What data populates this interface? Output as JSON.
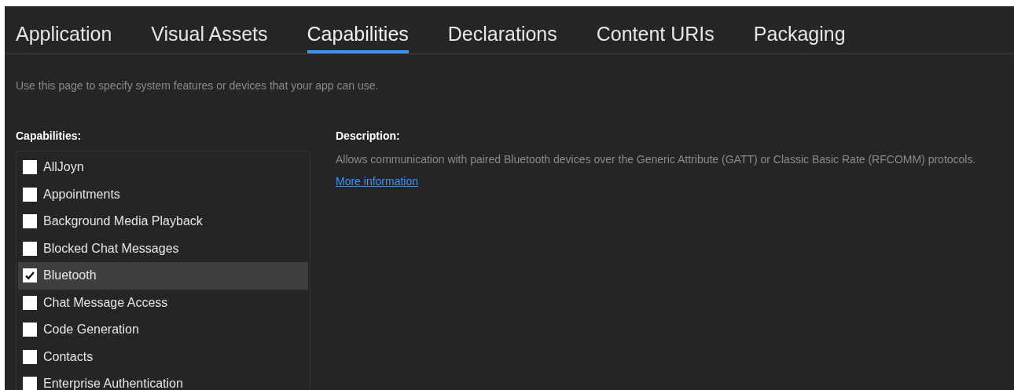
{
  "tabs": [
    {
      "label": "Application",
      "selected": false
    },
    {
      "label": "Visual Assets",
      "selected": false
    },
    {
      "label": "Capabilities",
      "selected": true
    },
    {
      "label": "Declarations",
      "selected": false
    },
    {
      "label": "Content URIs",
      "selected": false
    },
    {
      "label": "Packaging",
      "selected": false
    }
  ],
  "hint": "Use this page to specify system features or devices that your app can use.",
  "capabilities": {
    "heading": "Capabilities:",
    "items": [
      {
        "label": "AllJoyn",
        "checked": false,
        "selected": false
      },
      {
        "label": "Appointments",
        "checked": false,
        "selected": false
      },
      {
        "label": "Background Media Playback",
        "checked": false,
        "selected": false
      },
      {
        "label": "Blocked Chat Messages",
        "checked": false,
        "selected": false
      },
      {
        "label": "Bluetooth",
        "checked": true,
        "selected": true
      },
      {
        "label": "Chat Message Access",
        "checked": false,
        "selected": false
      },
      {
        "label": "Code Generation",
        "checked": false,
        "selected": false
      },
      {
        "label": "Contacts",
        "checked": false,
        "selected": false
      },
      {
        "label": "Enterprise Authentication",
        "checked": false,
        "selected": false
      }
    ]
  },
  "description": {
    "heading": "Description:",
    "text": "Allows communication with paired Bluetooth devices over the Generic Attribute (GATT) or Classic Basic Rate (RFCOMM) protocols.",
    "link": "More information"
  }
}
